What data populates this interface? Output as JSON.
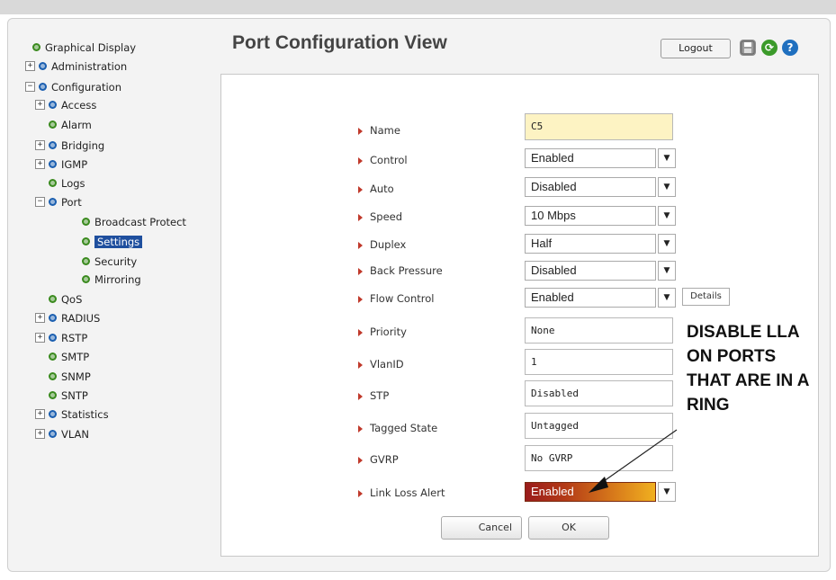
{
  "tree": {
    "items": [
      {
        "label": "Graphical Display"
      },
      {
        "label": "Administration"
      },
      {
        "label": "Configuration"
      },
      {
        "label": "Access"
      },
      {
        "label": "Alarm"
      },
      {
        "label": "Bridging"
      },
      {
        "label": "IGMP"
      },
      {
        "label": "Logs"
      },
      {
        "label": "Port"
      },
      {
        "label": "Broadcast Protect"
      },
      {
        "label": "Settings"
      },
      {
        "label": "Security"
      },
      {
        "label": "Mirroring"
      },
      {
        "label": "QoS"
      },
      {
        "label": "RADIUS"
      },
      {
        "label": "RSTP"
      },
      {
        "label": "SMTP"
      },
      {
        "label": "SNMP"
      },
      {
        "label": "SNTP"
      },
      {
        "label": "Statistics"
      },
      {
        "label": "VLAN"
      }
    ]
  },
  "header": {
    "title": "Port Configuration View",
    "logout_label": "Logout",
    "save_icon": "save-icon",
    "refresh_icon": "refresh-icon",
    "help_icon": "help-icon"
  },
  "form": {
    "name": {
      "label": "Name",
      "value": "C5"
    },
    "control": {
      "label": "Control",
      "value": "Enabled"
    },
    "auto": {
      "label": "Auto",
      "value": "Disabled"
    },
    "speed": {
      "label": "Speed",
      "value": "10 Mbps"
    },
    "duplex": {
      "label": "Duplex",
      "value": "Half"
    },
    "back_pressure": {
      "label": "Back Pressure",
      "value": "Disabled"
    },
    "flow_control": {
      "label": "Flow Control",
      "value": "Enabled",
      "details_label": "Details"
    },
    "priority": {
      "label": "Priority",
      "value": "None"
    },
    "vlanid": {
      "label": "VlanID",
      "value": "1"
    },
    "stp": {
      "label": "STP",
      "value": "Disabled"
    },
    "tagged_state": {
      "label": "Tagged State",
      "value": "Untagged"
    },
    "gvrp": {
      "label": "GVRP",
      "value": "No GVRP"
    },
    "link_loss_alert": {
      "label": "Link Loss Alert",
      "value": "Enabled"
    },
    "cancel_label": "Cancel",
    "ok_label": "OK"
  },
  "annotation": {
    "line1": "DISABLE LLA",
    "line2": "ON PORTS",
    "line3": "THAT ARE IN A",
    "line4": "RING"
  },
  "colors": {
    "selected": "#1f4f9e",
    "lla_gradient_start": "#9a1c1c",
    "lla_gradient_end": "#f0b020",
    "label_arrow": "#c0392b"
  }
}
